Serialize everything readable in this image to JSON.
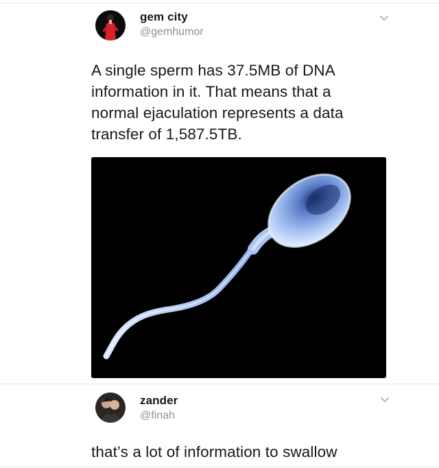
{
  "tweet": {
    "author_name": "gem city",
    "author_handle": "@gemhumor",
    "text_lines": [
      "A single sperm has 37.5MB of DNA",
      "information in it. That means that a",
      "normal ejaculation represents a data",
      "transfer of 1,587.5TB."
    ],
    "menu_icon": "chevron-down-icon",
    "media_icon": "sperm-cell-illustration"
  },
  "reply": {
    "author_name": "zander",
    "author_handle": "@finah",
    "text": "that’s a lot of information to swallow",
    "menu_icon": "chevron-down-icon"
  },
  "colors": {
    "handle": "#8a9299",
    "text": "#14171a",
    "media_bg": "#000000",
    "cell": "#8fb4f0"
  }
}
